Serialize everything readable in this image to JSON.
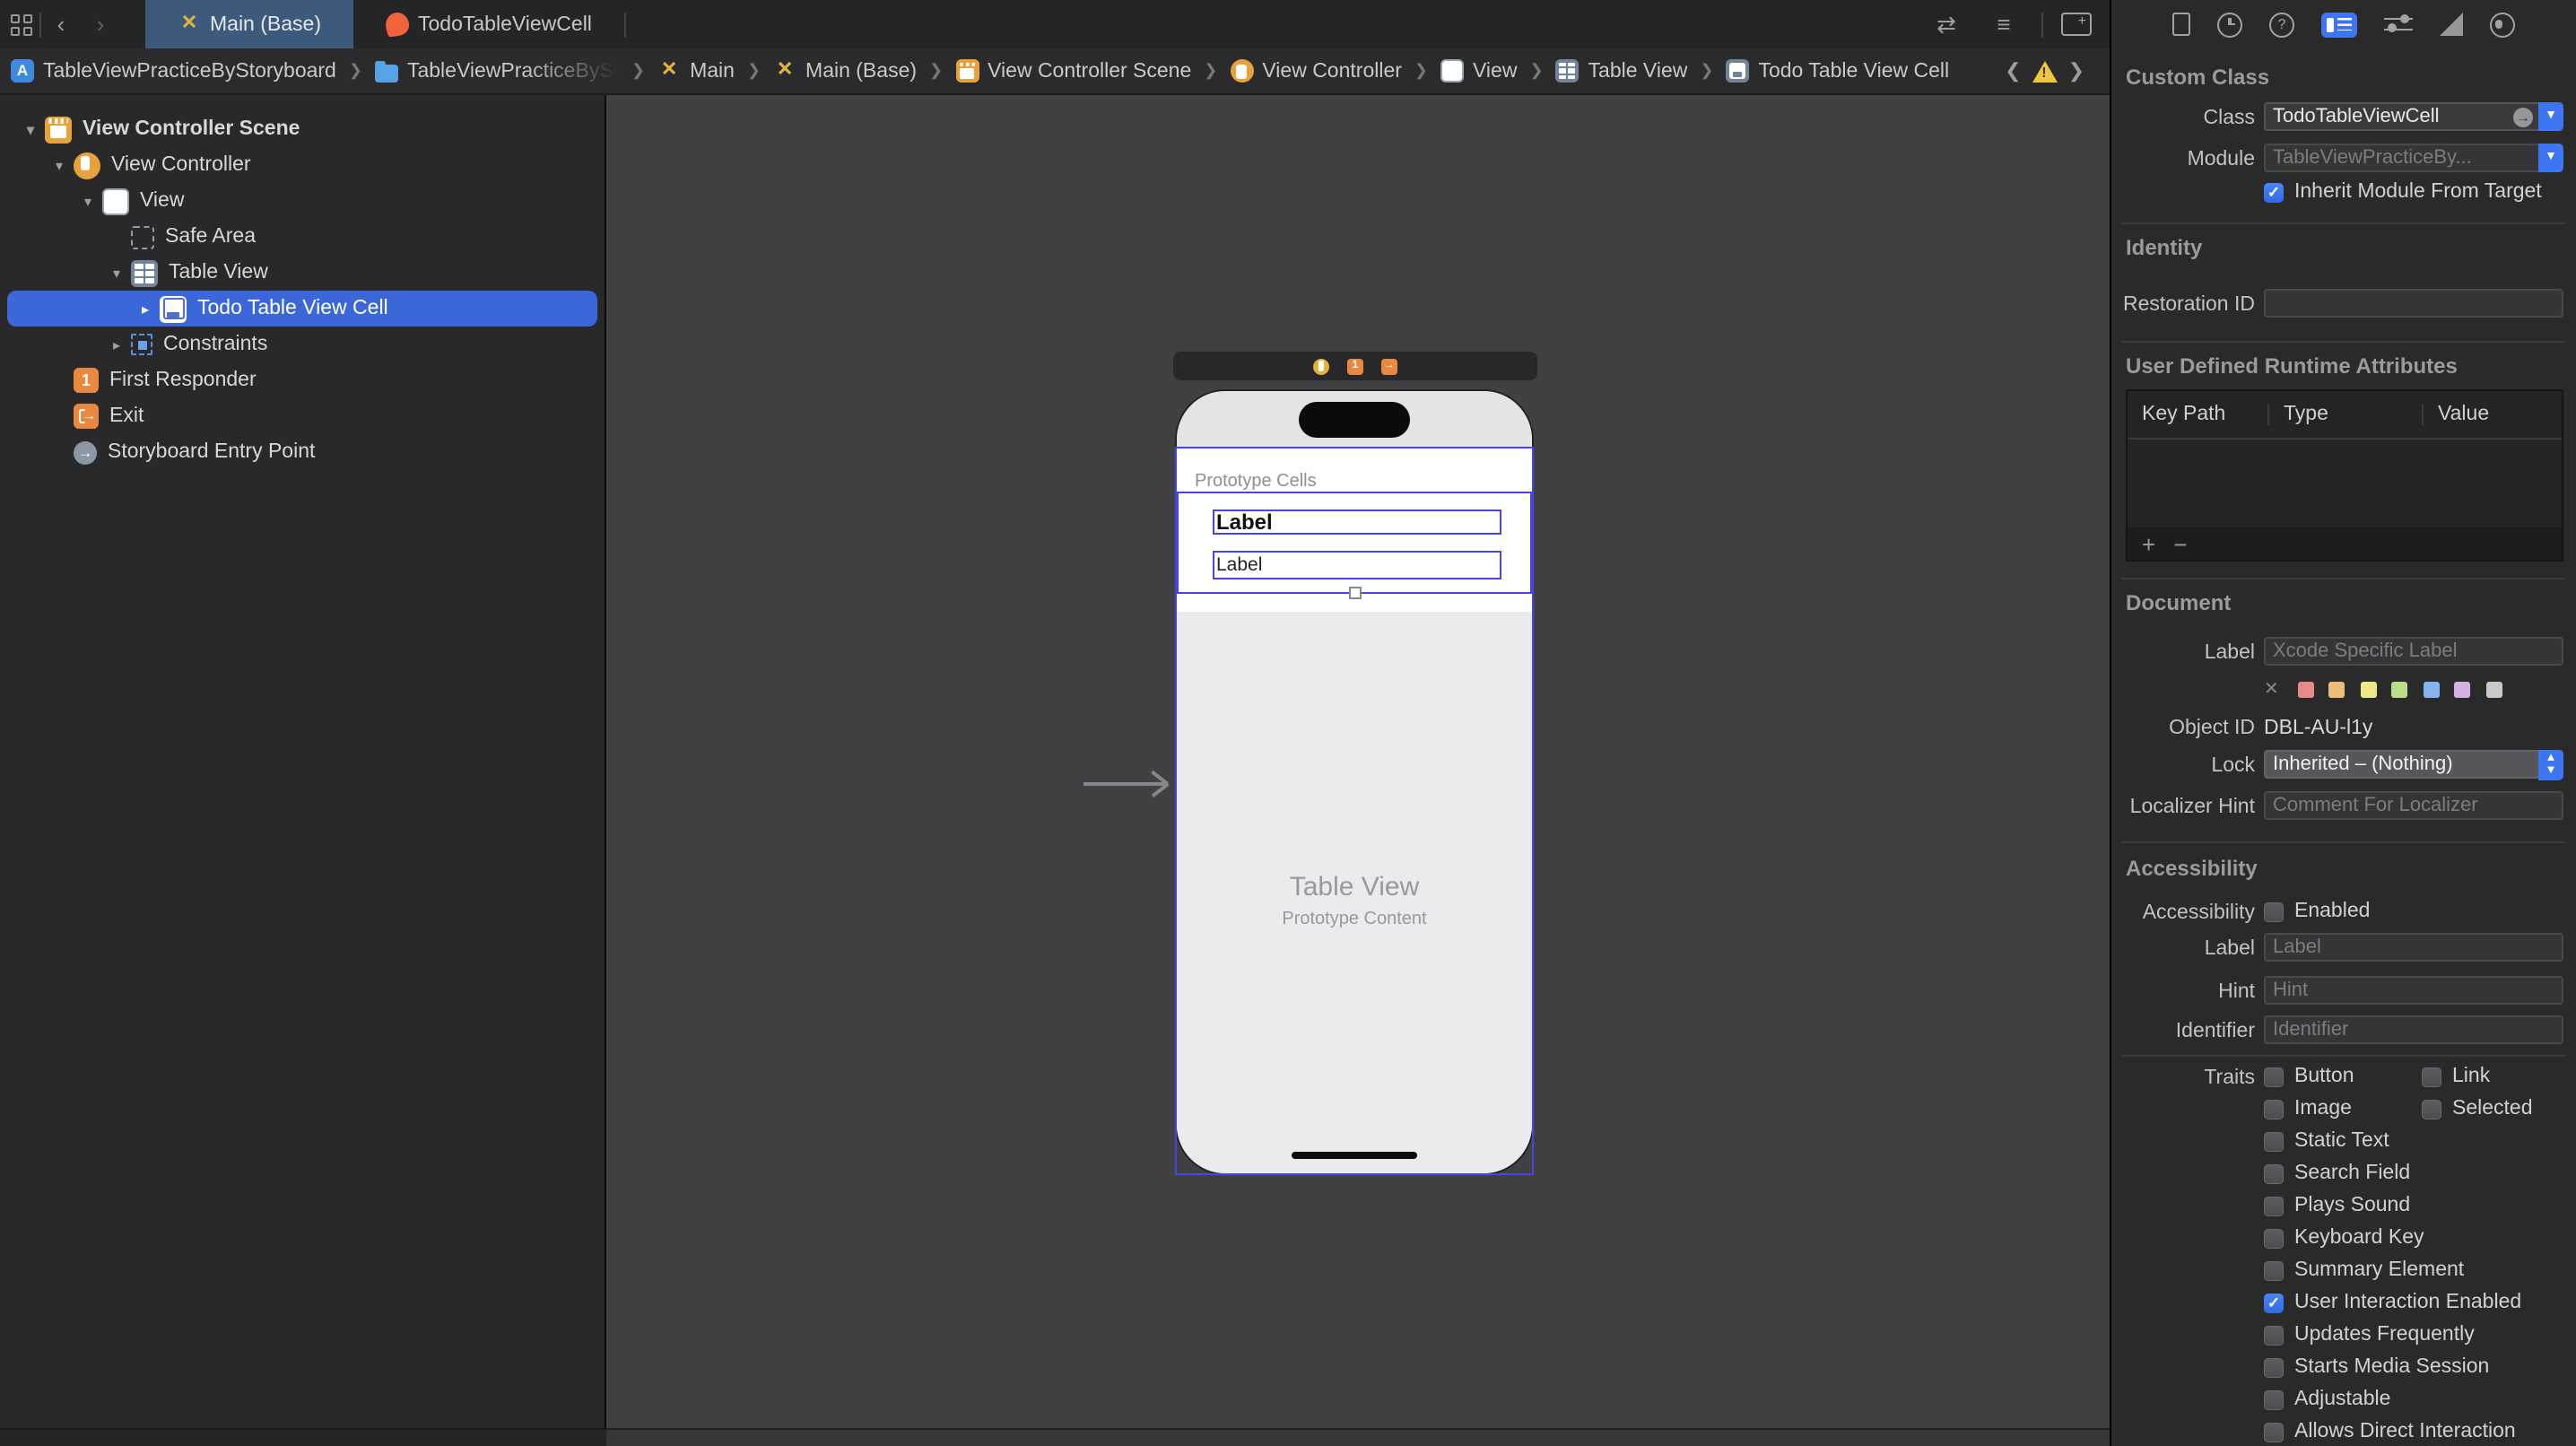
{
  "tab_bar": {
    "tabs": [
      {
        "label": "Main (Base)"
      },
      {
        "label": "TodoTableViewCell"
      }
    ]
  },
  "jump_bar": {
    "items": [
      "TableViewPracticeByStoryboard",
      "TableViewPracticeByStoryboa",
      "Main",
      "Main (Base)",
      "View Controller Scene",
      "View Controller",
      "View",
      "Table View",
      "Todo Table View Cell"
    ]
  },
  "outline": {
    "items": [
      {
        "label": "View Controller Scene"
      },
      {
        "label": "View Controller"
      },
      {
        "label": "View"
      },
      {
        "label": "Safe Area"
      },
      {
        "label": "Table View"
      },
      {
        "label": "Todo Table View Cell",
        "selected": true
      },
      {
        "label": "Constraints"
      },
      {
        "label": "First Responder"
      },
      {
        "label": "Exit"
      },
      {
        "label": "Storyboard Entry Point"
      }
    ]
  },
  "canvas": {
    "prototype_cells_label": "Prototype Cells",
    "cell_title_label": "Label",
    "cell_subtitle_label": "Label",
    "table_view_title": "Table View",
    "table_view_subtitle": "Prototype Content"
  },
  "inspector": {
    "custom_class": {
      "title": "Custom Class",
      "class_label": "Class",
      "class_value": "TodoTableViewCell",
      "module_label": "Module",
      "module_placeholder": "TableViewPracticeBy...",
      "inherit_label": "Inherit Module From Target",
      "inherit_checked": true
    },
    "identity": {
      "title": "Identity",
      "restoration_id_label": "Restoration ID",
      "restoration_id_value": ""
    },
    "runtime_attributes": {
      "title": "User Defined Runtime Attributes",
      "columns": [
        "Key Path",
        "Type",
        "Value"
      ],
      "rows": [],
      "add_label": "+",
      "remove_label": "−"
    },
    "document": {
      "title": "Document",
      "label_label": "Label",
      "label_placeholder": "Xcode Specific Label",
      "swatches": [
        "#e8888a",
        "#edbd7a",
        "#ece98b",
        "#bcdc8c",
        "#85b5ef",
        "#d5afe2",
        "#c9c9c9"
      ],
      "object_id_label": "Object ID",
      "object_id_value": "DBL-AU-l1y",
      "lock_label": "Lock",
      "lock_value": "Inherited – (Nothing)",
      "localizer_hint_label": "Localizer Hint",
      "localizer_hint_placeholder": "Comment For Localizer"
    },
    "accessibility": {
      "title": "Accessibility",
      "accessibility_label": "Accessibility",
      "enabled_label": "Enabled",
      "enabled_checked": false,
      "label_label": "Label",
      "label_placeholder": "Label",
      "hint_label": "Hint",
      "hint_placeholder": "Hint",
      "identifier_label": "Identifier",
      "identifier_placeholder": "Identifier",
      "traits_label": "Traits",
      "traits": [
        {
          "label": "Button",
          "checked": false
        },
        {
          "label": "Link",
          "checked": false
        },
        {
          "label": "Image",
          "checked": false
        },
        {
          "label": "Selected",
          "checked": false
        },
        {
          "label": "Static Text",
          "checked": false
        },
        {
          "label": "Search Field",
          "checked": false
        },
        {
          "label": "Plays Sound",
          "checked": false
        },
        {
          "label": "Keyboard Key",
          "checked": false
        },
        {
          "label": "Summary Element",
          "checked": false
        },
        {
          "label": "User Interaction Enabled",
          "checked": true
        },
        {
          "label": "Updates Frequently",
          "checked": false
        },
        {
          "label": "Starts Media Session",
          "checked": false
        },
        {
          "label": "Adjustable",
          "checked": false
        },
        {
          "label": "Allows Direct Interaction",
          "checked": false
        }
      ]
    }
  },
  "colors": {
    "accent_selection": "#3b67d9",
    "canvas_selection_border": "#4845e3",
    "active_tab": "#3c5a7c",
    "checkbox_blue": "#3674f5",
    "warning_yellow": "#f0c63e"
  }
}
